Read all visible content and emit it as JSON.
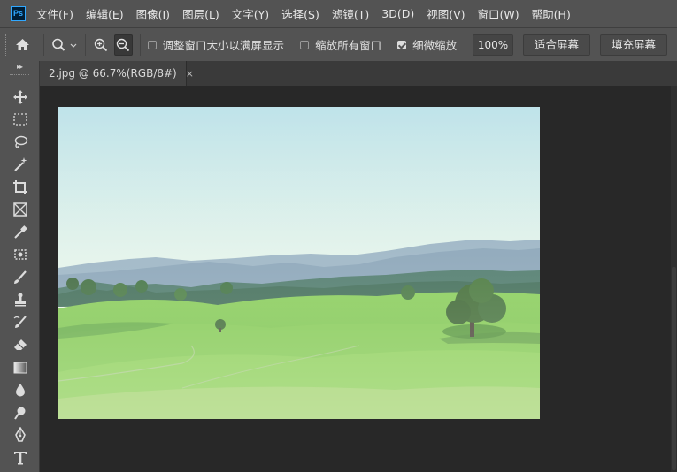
{
  "app": {
    "logo_text": "Ps"
  },
  "menu": [
    "文件(F)",
    "编辑(E)",
    "图像(I)",
    "图层(L)",
    "文字(Y)",
    "选择(S)",
    "滤镜(T)",
    "3D(D)",
    "视图(V)",
    "窗口(W)",
    "帮助(H)"
  ],
  "options": {
    "resize_windows_label": "调整窗口大小以满屏显示",
    "resize_windows_checked": false,
    "zoom_all_label": "缩放所有窗口",
    "zoom_all_checked": false,
    "scrubby_zoom_label": "细微缩放",
    "scrubby_zoom_checked": true,
    "zoom_value": "100%",
    "fit_screen_label": "适合屏幕",
    "fill_screen_label": "填充屏幕"
  },
  "document": {
    "tab_label": "2.jpg @ 66.7%(RGB/8#)",
    "close_glyph": "×"
  },
  "tools": [
    "move-tool-icon",
    "marquee-tool-icon",
    "lasso-tool-icon",
    "magic-wand-tool-icon",
    "crop-tool-icon",
    "frame-tool-icon",
    "eyedropper-tool-icon",
    "healing-brush-tool-icon",
    "brush-tool-icon",
    "clone-stamp-tool-icon",
    "history-brush-tool-icon",
    "eraser-tool-icon",
    "gradient-tool-icon",
    "blur-tool-icon",
    "dodge-tool-icon",
    "pen-tool-icon",
    "type-tool-icon"
  ],
  "colors": {
    "chrome": "#535353",
    "workspace": "#282828",
    "ps_blue": "#31a8ff"
  }
}
